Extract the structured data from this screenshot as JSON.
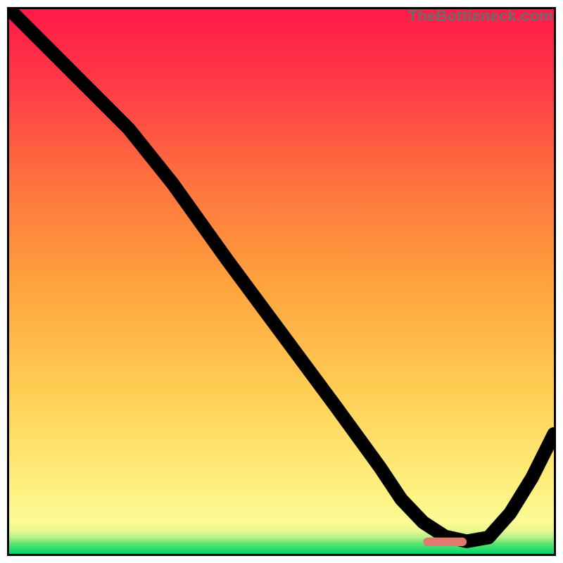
{
  "watermark": "TheBottleneck.com",
  "marker_color": "#e07a6f",
  "chart_data": {
    "type": "line",
    "title": "",
    "xlabel": "",
    "ylabel": "",
    "xlim": [
      0,
      100
    ],
    "ylim": [
      0,
      100
    ],
    "grid": false,
    "legend": false,
    "gradient": {
      "direction": "to top",
      "stops": [
        {
          "offset": 0.0,
          "color": "#00d66b"
        },
        {
          "offset": 0.018,
          "color": "#55e470"
        },
        {
          "offset": 0.03,
          "color": "#b6f18a"
        },
        {
          "offset": 0.042,
          "color": "#e9f78f"
        },
        {
          "offset": 0.06,
          "color": "#fcfb95"
        },
        {
          "offset": 0.12,
          "color": "#fff07f"
        },
        {
          "offset": 0.3,
          "color": "#ffce53"
        },
        {
          "offset": 0.5,
          "color": "#ffa23d"
        },
        {
          "offset": 0.7,
          "color": "#ff6d3e"
        },
        {
          "offset": 0.85,
          "color": "#ff3d46"
        },
        {
          "offset": 1.0,
          "color": "#ff1a49"
        }
      ]
    },
    "series": [
      {
        "name": "bottleneck-curve",
        "x": [
          0.5,
          10,
          22,
          30,
          40,
          50,
          60,
          68,
          72,
          76,
          80,
          84,
          88,
          92,
          96,
          100
        ],
        "y": [
          99.5,
          90,
          78,
          68,
          54,
          40.5,
          27,
          16,
          10,
          5.8,
          3.2,
          2.3,
          3.0,
          7.5,
          14,
          22
        ]
      }
    ],
    "annotations": [
      {
        "type": "marker-bar",
        "name": "optimal-range",
        "x_start": 76,
        "x_end": 84,
        "y": 2.2,
        "height": 1.6
      }
    ]
  }
}
